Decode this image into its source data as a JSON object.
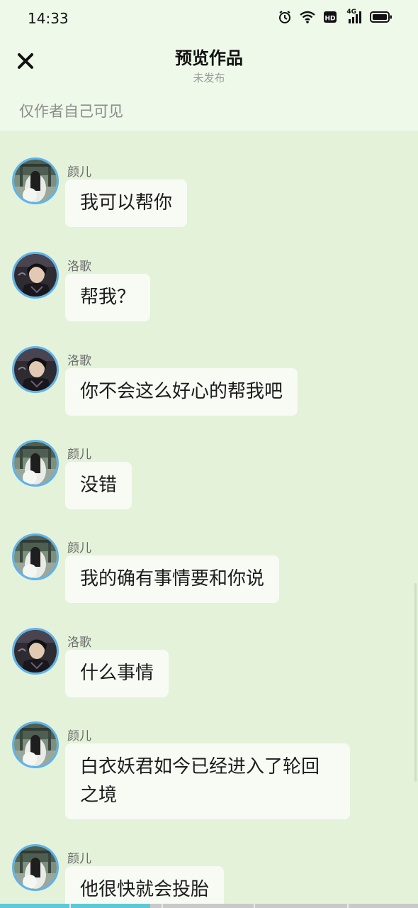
{
  "status_bar": {
    "time": "14:33",
    "icons": [
      "alarm-icon",
      "wifi-icon",
      "hd-icon",
      "signal-4g-icon",
      "battery-icon"
    ],
    "network_label": "4G"
  },
  "header": {
    "close_icon": "close-icon",
    "title": "预览作品",
    "subtitle": "未发布",
    "visibility_note": "仅作者自己可见"
  },
  "messages": [
    {
      "sender": "颜儿",
      "avatar": "yaner",
      "text": "我可以帮你"
    },
    {
      "sender": "洛歌",
      "avatar": "luoge",
      "text": "帮我？"
    },
    {
      "sender": "洛歌",
      "avatar": "luoge",
      "text": "你不会这么好心的帮我吧"
    },
    {
      "sender": "颜儿",
      "avatar": "yaner",
      "text": "没错"
    },
    {
      "sender": "颜儿",
      "avatar": "yaner",
      "text": "我的确有事情要和你说"
    },
    {
      "sender": "洛歌",
      "avatar": "luoge",
      "text": "什么事情"
    },
    {
      "sender": "颜儿",
      "avatar": "yaner",
      "text": "白衣妖君如今已经进入了轮回之境"
    },
    {
      "sender": "颜儿",
      "avatar": "yaner",
      "text": "他很快就会投胎"
    }
  ],
  "progress": {
    "played_fraction": 0.36
  },
  "colors": {
    "background": "#e4f2da",
    "header_background": "#eef9ea",
    "bubble": "#f7fbf4",
    "avatar_ring": "#5eb3ea",
    "progress_fill": "#5cc9d6"
  }
}
